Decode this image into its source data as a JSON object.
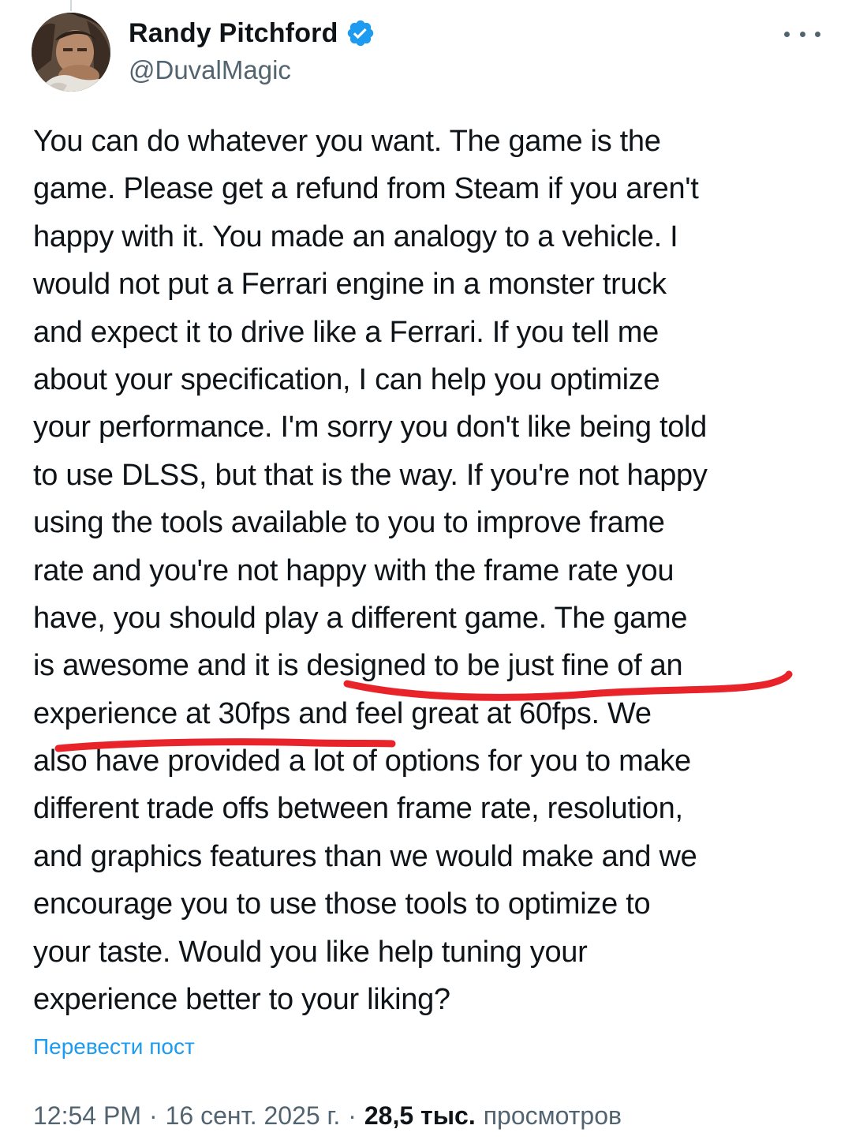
{
  "author": {
    "display_name": "Randy Pitchford",
    "handle": "@DuvalMagic",
    "verified": true
  },
  "post": {
    "lines": [
      "You can do whatever you want. The game is the",
      "game. Please get a refund from Steam if you aren't",
      "happy with it. You made an analogy to a vehicle. I",
      "would not put a Ferrari engine in a monster truck",
      "and expect it to drive like a Ferrari. If you tell me",
      "about your specification, I can help you optimize",
      "your performance. I'm sorry you don't like being told",
      "to use DLSS, but that is the way. If you're not happy",
      "using the tools available to you to improve frame",
      "rate and you're not happy with the frame rate you",
      "have, you should play a different game.  The game",
      "is awesome and it is designed to be just fine of an",
      "experience at 30fps and feel great at 60fps. We",
      "also have provided a lot of options for you to make",
      "different trade offs between frame rate, resolution,",
      "and graphics features than we would make and we",
      "encourage you to use those tools to optimize to",
      "your taste. Would you like help tuning your",
      "experience better to your liking?"
    ],
    "translate_label": "Перевести пост"
  },
  "meta": {
    "time": "12:54 PM",
    "separator": "·",
    "date": "16 сент. 2025 г.",
    "views_count": "28,5 тыс.",
    "views_label": "просмотров"
  },
  "colors": {
    "text": "#0f1419",
    "secondary": "#536471",
    "link": "#1d9bf0",
    "verified": "#1d9bf0",
    "annotation": "#e8242a"
  },
  "icons": {
    "verified": "verified-badge-icon",
    "more": "more-horizontal-icon"
  }
}
